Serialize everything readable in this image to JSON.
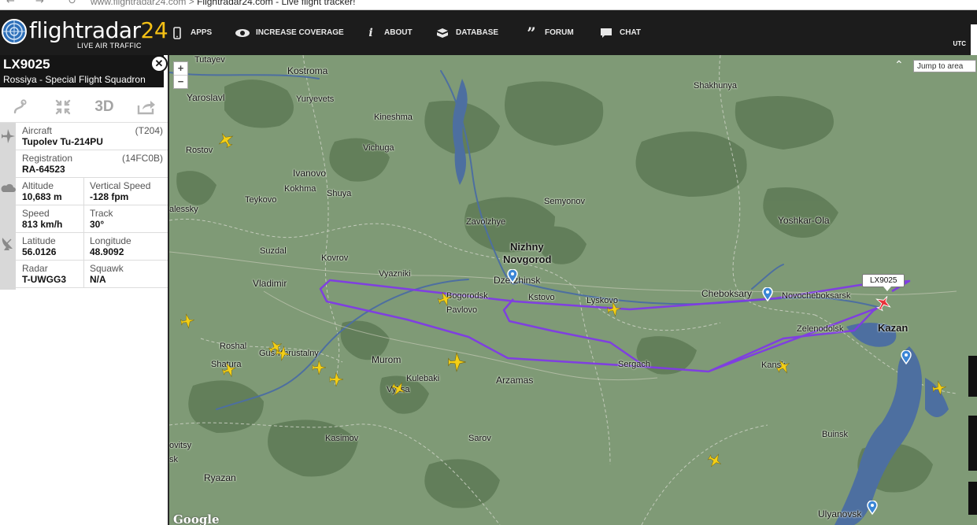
{
  "browser": {
    "url_text": "www.flightradar24.com",
    "url_sep": " > ",
    "page_title": "Flightradar24.com - Live flight tracker!"
  },
  "header": {
    "logo_word": "flightradar",
    "logo_num": "24",
    "logo_subtitle": "LIVE AIR TRAFFIC",
    "nav": [
      {
        "label": "APPS",
        "icon": "phone-icon"
      },
      {
        "label": "INCREASE COVERAGE",
        "icon": "eye-icon"
      },
      {
        "label": "ABOUT",
        "icon": "info-icon"
      },
      {
        "label": "DATABASE",
        "icon": "database-icon"
      },
      {
        "label": "FORUM",
        "icon": "quote-icon"
      },
      {
        "label": "CHAT",
        "icon": "chat-bubble-icon"
      }
    ],
    "utc_label": "UTC"
  },
  "flight_panel": {
    "flight_id": "LX9025",
    "airline": "Rossiya - Special Flight Squadron",
    "tools": [
      "route-icon",
      "collapse-icon",
      "3D",
      "share-icon"
    ],
    "details": {
      "aircraft_label": "Aircraft",
      "aircraft_code": "(T204)",
      "aircraft_value": "Tupolev Tu-214PU",
      "registration_label": "Registration",
      "registration_code": "(14FC0B)",
      "registration_value": "RA-64523",
      "altitude_label": "Altitude",
      "altitude_value": "10,683 m",
      "vspeed_label": "Vertical Speed",
      "vspeed_value": "-128 fpm",
      "speed_label": "Speed",
      "speed_value": "813 km/h",
      "track_label": "Track",
      "track_value": "30°",
      "latitude_label": "Latitude",
      "latitude_value": "56.0126",
      "longitude_label": "Longitude",
      "longitude_value": "48.9092",
      "radar_label": "Radar",
      "radar_value": "T-UWGG3",
      "squawk_label": "Squawk",
      "squawk_value": "N/A"
    }
  },
  "map": {
    "jump_to_area": "Jump to area",
    "zoom_in": "+",
    "zoom_out": "−",
    "selected_callsign": "LX9025",
    "attribution": "Google",
    "places": [
      "Tutayev",
      "Kostroma",
      "Shakhunya",
      "Yaroslavl",
      "Yuryevets",
      "Kineshma",
      "Rostov",
      "Vichuga",
      "Ivanovo",
      "Kokhma",
      "Shuya",
      "Semyonov",
      "Teykovo",
      "Zavolzhye",
      "Yoshkar-Ola",
      "alessky",
      "Suzdal",
      "Kovrov",
      "Nizhny",
      "Novgorod",
      "Vladimir",
      "Vyazniki",
      "Dzerzhinsk",
      "Cheboksary",
      "Novocheboksarsk",
      "Bogorodsk",
      "Kstovo",
      "Lyskovo",
      "Pavlovo",
      "Zelenodolsk",
      "Kazan",
      "Roshal",
      "Gus-Khrustalny",
      "Murom",
      "Sergach",
      "Shatura",
      "Kulebaki",
      "Arzamas",
      "Kansk",
      "Vyksa",
      "Buinsk",
      "Kasimov",
      "Sarov",
      "ovitsy",
      "Ryazan",
      "sk",
      "Ulyanovsk"
    ]
  },
  "colors": {
    "track": "#7f3ae6",
    "plane": "#f4cf15",
    "selected_plane": "#e8323a",
    "map_bg": "#7f9a76"
  }
}
